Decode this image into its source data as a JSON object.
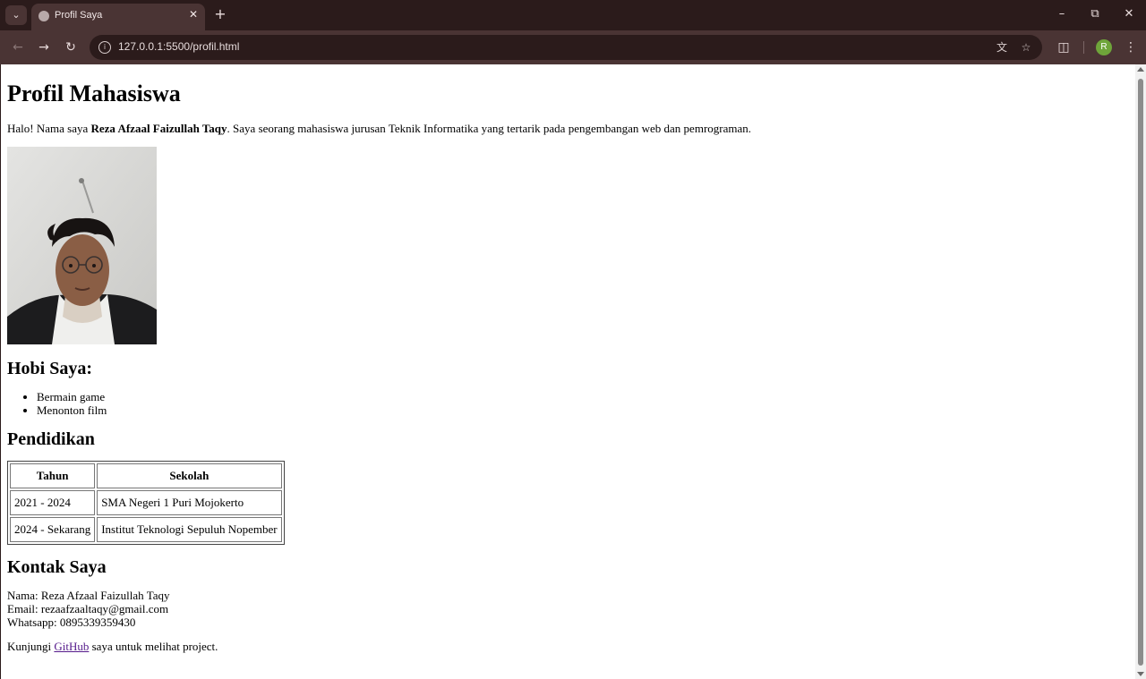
{
  "browser": {
    "tab_title": "Profil Saya",
    "url": "127.0.0.1:5500/profil.html",
    "profile_initial": "R",
    "accent_color": "#4a3434",
    "icons": [
      "tab-menu-icon",
      "globe-icon",
      "close-icon",
      "plus-icon",
      "minimize-icon",
      "restore-icon",
      "window-close-icon",
      "back-icon",
      "forward-icon",
      "reload-icon",
      "info-icon",
      "translate-icon",
      "star-icon",
      "extensions-icon",
      "kebab-menu-icon"
    ]
  },
  "page": {
    "title": "Profil Mahasiswa",
    "intro_prefix": "Halo! Nama saya ",
    "intro_name": "Reza Afzaal Faizullah Taqy",
    "intro_suffix": ". Saya seorang mahasiswa jurusan Teknik Informatika yang tertarik pada pengembangan web dan pemrograman.",
    "hobbies_heading": "Hobi Saya:",
    "hobbies": [
      "Bermain game",
      "Menonton film"
    ],
    "education_heading": "Pendidikan",
    "education_table": {
      "headers": [
        "Tahun",
        "Sekolah"
      ],
      "rows": [
        [
          "2021 - 2024",
          "SMA Negeri 1 Puri Mojokerto"
        ],
        [
          "2024 - Sekarang",
          "Institut Teknologi Sepuluh Nopember"
        ]
      ]
    },
    "contact_heading": "Kontak Saya",
    "contact": {
      "name_line": "Nama: Reza Afzaal Faizullah Taqy",
      "email_line": "Email: rezaafzaaltaqy@gmail.com",
      "whatsapp_line": "Whatsapp: 0895339359430"
    },
    "footer_prefix": "Kunjungi ",
    "footer_link": "GitHub",
    "footer_suffix": " saya untuk melihat project."
  }
}
